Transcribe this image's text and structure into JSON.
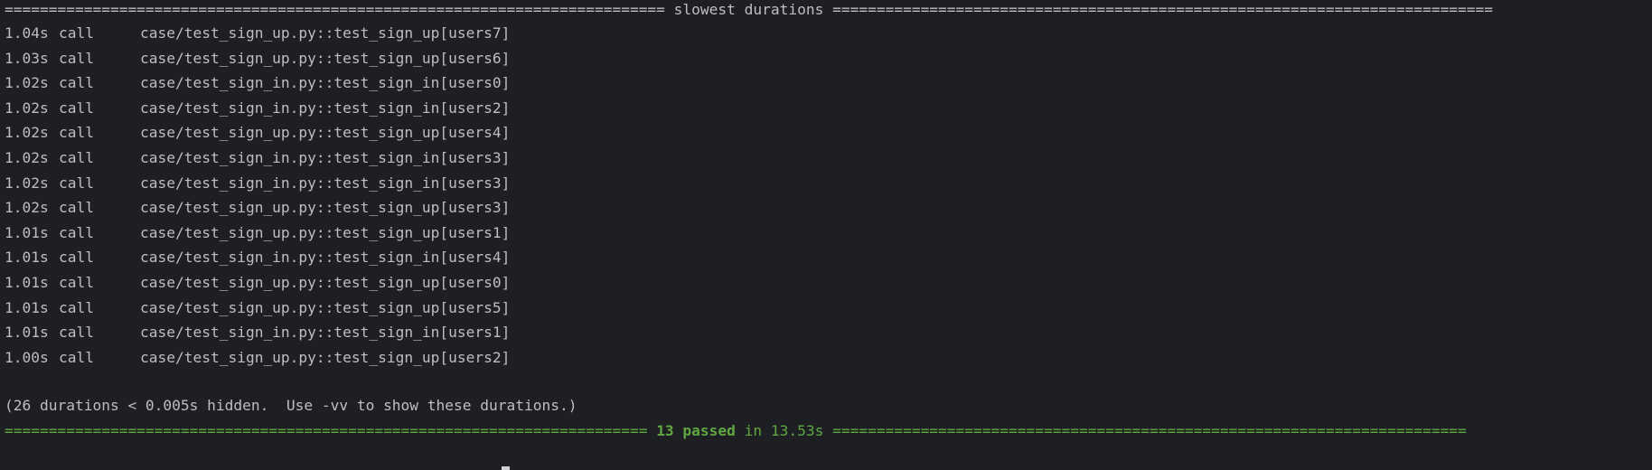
{
  "header": {
    "left_rule": "===========================================================================",
    "title": " slowest durations ",
    "right_rule": "==========================================================================="
  },
  "durations": [
    {
      "duration": "1.04s",
      "when": "call",
      "test": "case/test_sign_up.py::test_sign_up[users7]"
    },
    {
      "duration": "1.03s",
      "when": "call",
      "test": "case/test_sign_up.py::test_sign_up[users6]"
    },
    {
      "duration": "1.02s",
      "when": "call",
      "test": "case/test_sign_in.py::test_sign_in[users0]"
    },
    {
      "duration": "1.02s",
      "when": "call",
      "test": "case/test_sign_in.py::test_sign_in[users2]"
    },
    {
      "duration": "1.02s",
      "when": "call",
      "test": "case/test_sign_up.py::test_sign_up[users4]"
    },
    {
      "duration": "1.02s",
      "when": "call",
      "test": "case/test_sign_in.py::test_sign_in[users3]"
    },
    {
      "duration": "1.02s",
      "when": "call",
      "test": "case/test_sign_in.py::test_sign_in[users3]"
    },
    {
      "duration": "1.02s",
      "when": "call",
      "test": "case/test_sign_up.py::test_sign_up[users3]"
    },
    {
      "duration": "1.01s",
      "when": "call",
      "test": "case/test_sign_up.py::test_sign_up[users1]"
    },
    {
      "duration": "1.01s",
      "when": "call",
      "test": "case/test_sign_in.py::test_sign_in[users4]"
    },
    {
      "duration": "1.01s",
      "when": "call",
      "test": "case/test_sign_up.py::test_sign_up[users0]"
    },
    {
      "duration": "1.01s",
      "when": "call",
      "test": "case/test_sign_up.py::test_sign_up[users5]"
    },
    {
      "duration": "1.01s",
      "when": "call",
      "test": "case/test_sign_in.py::test_sign_in[users1]"
    },
    {
      "duration": "1.00s",
      "when": "call",
      "test": "case/test_sign_up.py::test_sign_up[users2]"
    }
  ],
  "hidden_note": "(26 durations < 0.005s hidden.  Use -vv to show these durations.)",
  "summary": {
    "left_rule": "=========================================================================",
    "passed": "13 passed",
    "time": " in 13.53s ",
    "right_rule": "========================================================================"
  },
  "colors": {
    "background": "#1e1f22",
    "text": "#bcbec4",
    "success": "#5fa740"
  }
}
